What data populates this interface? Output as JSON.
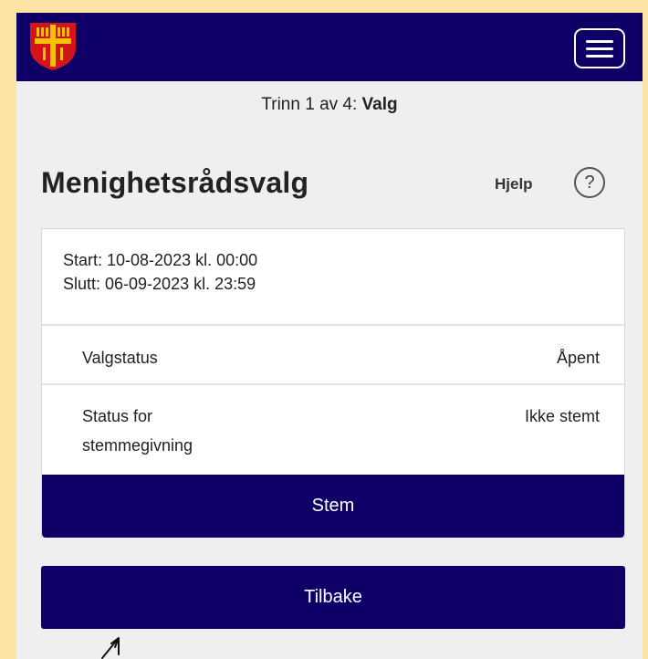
{
  "header": {
    "logo_icon": "church-cross-shield-icon",
    "menu_icon": "hamburger-menu-icon",
    "bar_color": "#0e0066"
  },
  "progress": {
    "prefix": "Trinn 1 av 4: ",
    "step_name": "Valg"
  },
  "page": {
    "title": "Menighetsrådsvalg",
    "help_label": "Hjelp",
    "help_icon_glyph": "?"
  },
  "election": {
    "start": "Start: 10-08-2023 kl. 00:00",
    "end": "Slutt: 06-09-2023 kl. 23:59",
    "rows": [
      {
        "label": "Valgstatus",
        "value": "Åpent"
      },
      {
        "label": "Status for",
        "label2": "stemmegivning",
        "value": "Ikke stemt"
      }
    ]
  },
  "actions": {
    "vote_label": "Stem",
    "back_label": "Tilbake"
  }
}
